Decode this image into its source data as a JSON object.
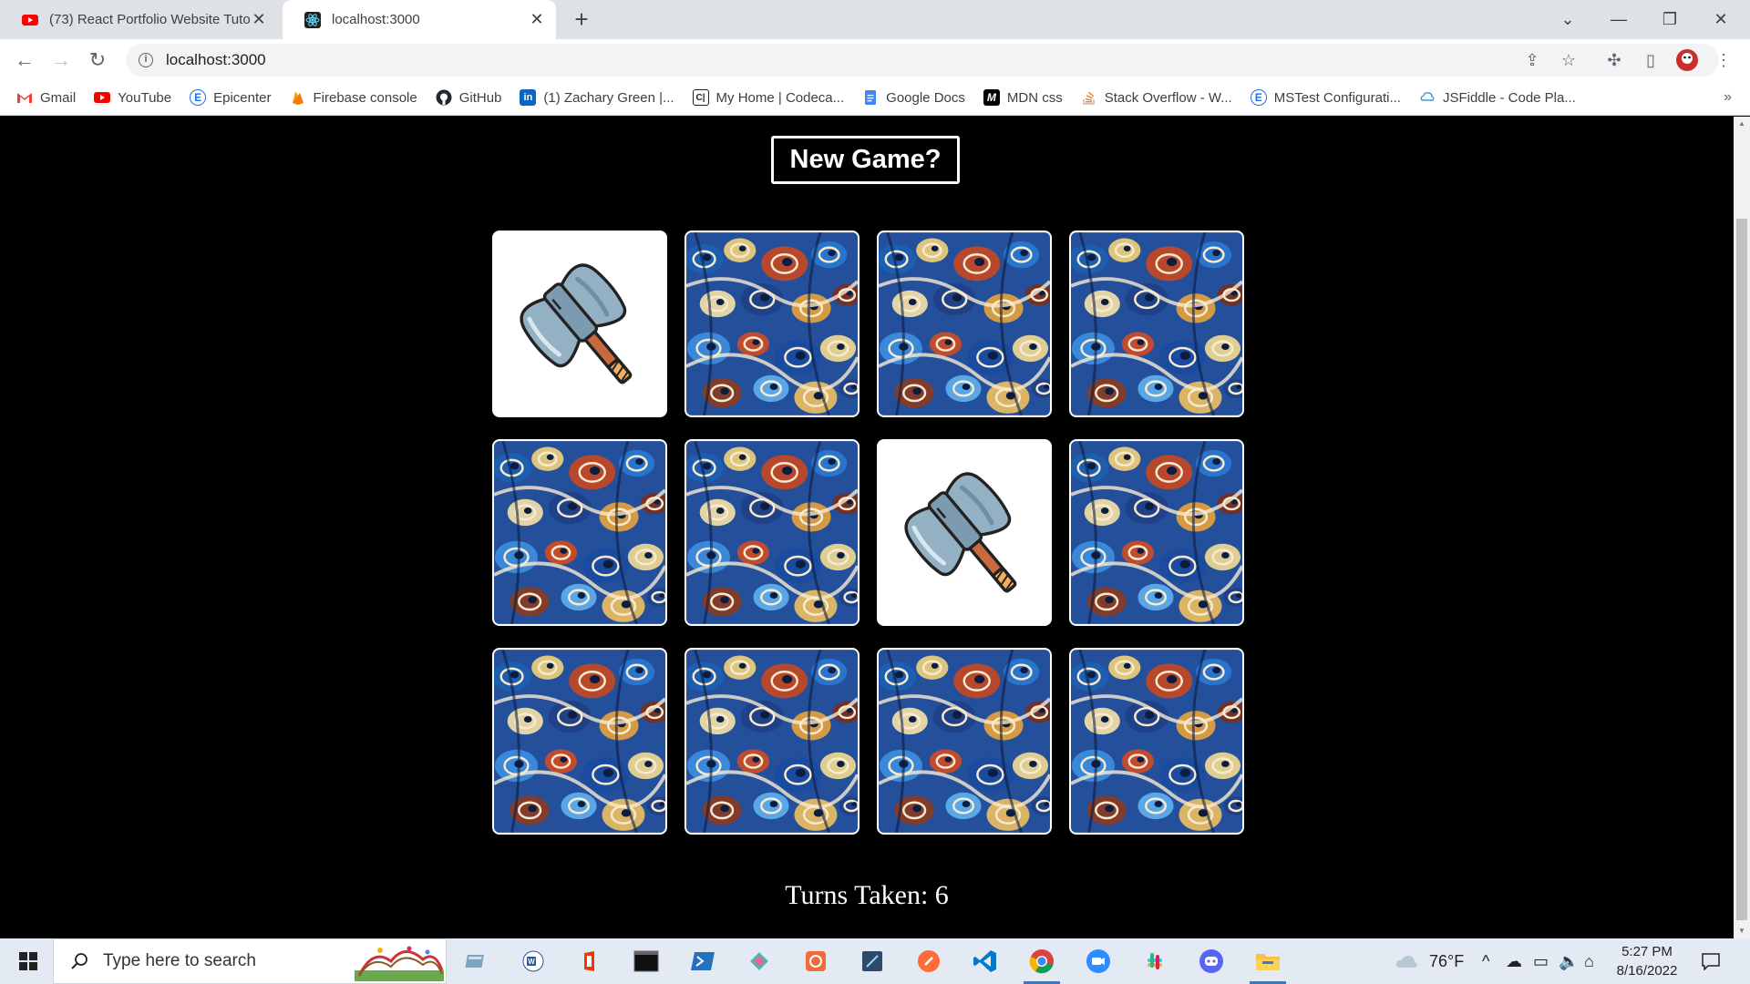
{
  "browser": {
    "tabs": [
      {
        "title": "(73) React Portfolio Website Tuto",
        "favicon": "youtube-icon",
        "active": false
      },
      {
        "title": "localhost:3000",
        "favicon": "react-icon",
        "active": true
      }
    ],
    "url": "localhost:3000",
    "bookmarks": [
      {
        "label": "Gmail",
        "icon": "gmail-icon",
        "color": "#ea4335"
      },
      {
        "label": "YouTube",
        "icon": "youtube-icon",
        "color": "#ff0000"
      },
      {
        "label": "Epicenter",
        "icon": "epicenter-icon",
        "color": "#1a73e8"
      },
      {
        "label": "Firebase console",
        "icon": "firebase-icon",
        "color": "#ffa000"
      },
      {
        "label": "GitHub",
        "icon": "github-icon",
        "color": "#24292e"
      },
      {
        "label": "(1) Zachary Green |...",
        "icon": "linkedin-icon",
        "color": "#0a66c2"
      },
      {
        "label": "My Home | Codeca...",
        "icon": "codecademy-icon",
        "color": "#1f1f1f"
      },
      {
        "label": "Google Docs",
        "icon": "google-docs-icon",
        "color": "#4285f4"
      },
      {
        "label": "MDN css",
        "icon": "mdn-icon",
        "color": "#000000"
      },
      {
        "label": "Stack Overflow - W...",
        "icon": "stackoverflow-icon",
        "color": "#f48024"
      },
      {
        "label": "MSTest Configurati...",
        "icon": "edge-icon",
        "color": "#1a73e8"
      },
      {
        "label": "JSFiddle - Code Pla...",
        "icon": "jsfiddle-icon",
        "color": "#3a9ad9"
      }
    ]
  },
  "game": {
    "new_game_label": "New Game?",
    "turns_label": "Turns Taken: 6",
    "cards": [
      {
        "face": "up",
        "image": "axe"
      },
      {
        "face": "down",
        "image": "pattern"
      },
      {
        "face": "down",
        "image": "pattern"
      },
      {
        "face": "down",
        "image": "pattern"
      },
      {
        "face": "down",
        "image": "pattern"
      },
      {
        "face": "down",
        "image": "pattern"
      },
      {
        "face": "up",
        "image": "axe"
      },
      {
        "face": "down",
        "image": "pattern"
      },
      {
        "face": "down",
        "image": "pattern"
      },
      {
        "face": "down",
        "image": "pattern"
      },
      {
        "face": "down",
        "image": "pattern"
      },
      {
        "face": "down",
        "image": "pattern"
      }
    ]
  },
  "taskbar": {
    "search_placeholder": "Type here to search",
    "weather": "76°F",
    "time": "5:27 PM",
    "date": "8/16/2022"
  }
}
